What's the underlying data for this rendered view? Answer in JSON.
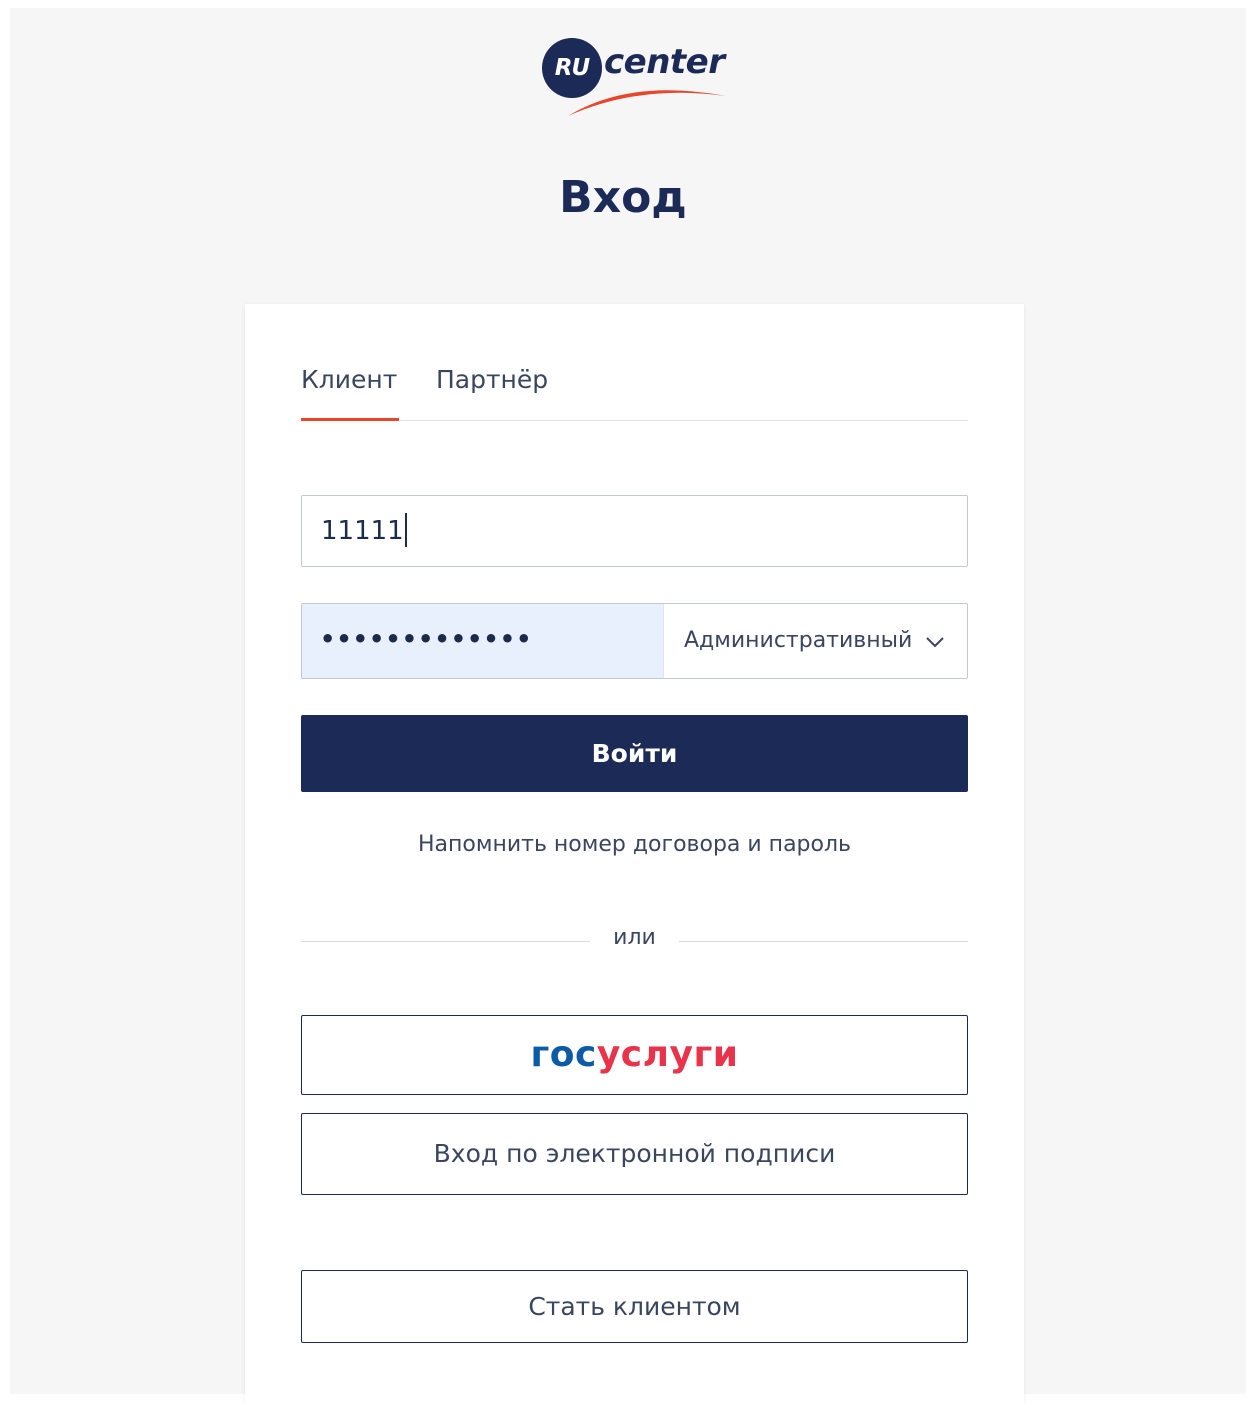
{
  "logo": {
    "badge_text": "RU",
    "word_text": "center",
    "colors": {
      "navy": "#1b2a57",
      "red": "#e8452b"
    }
  },
  "page": {
    "title": "Вход"
  },
  "tabs": [
    {
      "label": "Клиент",
      "active": true
    },
    {
      "label": "Партнёр",
      "active": false
    }
  ],
  "form": {
    "contract_value": "11111",
    "password_mask": "•••••••••••••",
    "password_type_selected": "Административный",
    "login_button": "Войти",
    "remind_link": "Напомнить номер договора и пароль",
    "divider_text": "или"
  },
  "alt_login": {
    "gosuslugi_part1": "гос",
    "gosuslugi_part2": "услуги",
    "signature_button": "Вход по электронной подписи",
    "become_client_button": "Стать клиентом"
  },
  "theme": {
    "accent_red": "#e8452b",
    "primary_navy": "#1b2a57",
    "autofill_bg": "#e8f0fe",
    "gosuslugi_blue": "#0d5aa7",
    "gosuslugi_red": "#e8334a"
  }
}
